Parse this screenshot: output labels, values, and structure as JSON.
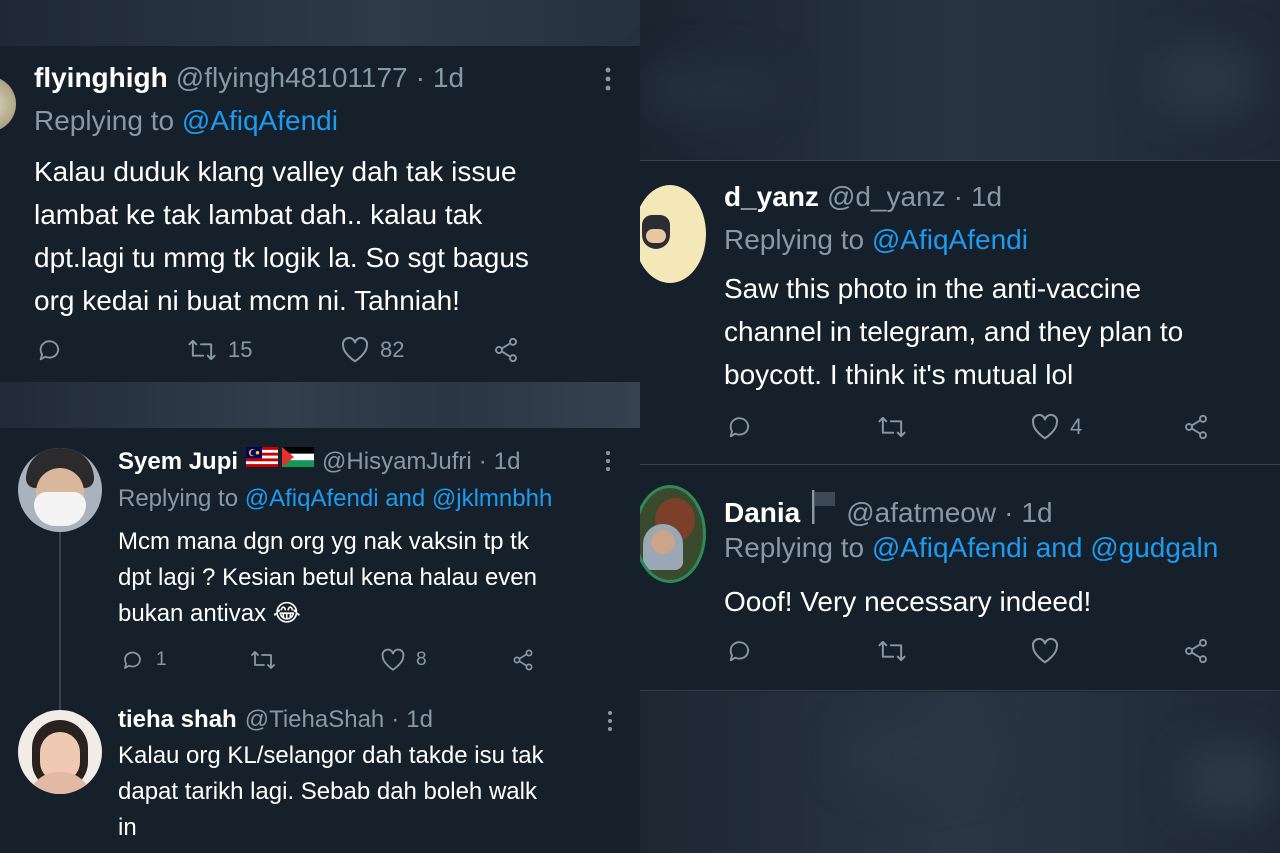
{
  "tweets": [
    {
      "name": "flyinghigh",
      "handle": "@flyingh48101177",
      "time": "1d",
      "replying_prefix": "Replying to",
      "mentions": "@AfiqAfendi",
      "text_lines": [
        "Kalau duduk klang valley dah tak issue",
        "lambat ke tak lambat dah.. kalau tak",
        "dpt.lagi tu mmg tk logik la. So sgt bagus",
        "org kedai ni buat mcm ni. Tahniah!"
      ],
      "retweets": "15",
      "likes": "82"
    },
    {
      "name": "Syem Jupi",
      "handle": "@HisyamJufri",
      "time": "1d",
      "replying_prefix": "Replying to",
      "mentions": "@AfiqAfendi and @jklmnbhh",
      "text_lines": [
        "Mcm mana dgn org yg nak vaksin tp tk",
        "dpt lagi ? Kesian betul kena halau even",
        "bukan antivax 😂"
      ],
      "replies": "1",
      "likes": "8"
    },
    {
      "name": "tieha shah",
      "handle": "@TiehaShah",
      "time": "1d",
      "text_lines": [
        "Kalau org KL/selangor dah takde isu tak",
        "dapat tarikh lagi. Sebab dah boleh walk",
        "in"
      ]
    },
    {
      "name": "d_yanz",
      "handle": "@d_yanz",
      "time": "1d",
      "replying_prefix": "Replying to",
      "mentions": "@AfiqAfendi",
      "text_lines": [
        "Saw this photo in the anti-vaccine",
        "channel in telegram, and they plan to",
        "boycott. I think it's mutual lol"
      ],
      "likes": "4"
    },
    {
      "name": "Dania",
      "handle": "@afatmeow",
      "time": "1d",
      "replying_prefix": "Replying to",
      "mentions": "@AfiqAfendi and @gudgaln",
      "text_lines": [
        "Ooof! Very necessary indeed!"
      ]
    }
  ],
  "separator": "·",
  "colors": {
    "background": "#15202b",
    "secondary_text": "#8899a6",
    "link": "#1d9bf0",
    "divider": "#38444d"
  },
  "icons": [
    "reply-icon",
    "retweet-icon",
    "like-icon",
    "share-icon",
    "more-icon"
  ]
}
